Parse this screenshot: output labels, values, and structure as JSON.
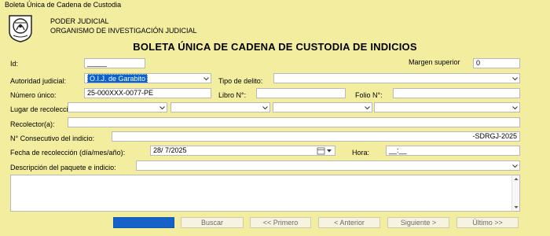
{
  "window": {
    "title": "Boleta Única de Cadena de Custodia"
  },
  "header": {
    "org_line1": "PODER JUDICIAL",
    "org_line2": "ORGANISMO DE INVESTIGACIÓN JUDICIAL",
    "title": "BOLETA ÚNICA DE CADENA DE CUSTODIA DE INDICIOS"
  },
  "form": {
    "id_label": "Id:",
    "id_value": "_____",
    "margin_label": "Margen superior",
    "margin_value": "0",
    "authority_label": "Autoridad judicial:",
    "authority_value": "O.I.J. de Garabito",
    "crime_type_label": "Tipo de delito:",
    "crime_type_value": "",
    "unique_number_label": "Número único:",
    "unique_number_value": "25-000XXX-0077-PE",
    "book_label": "Libro N°:",
    "book_value": "",
    "folio_label": "Folio N°:",
    "folio_value": "",
    "collection_place_label": "Lugar de recolección:",
    "collector_label": "Recolector(a):",
    "collector_value": "",
    "consecutive_label": "N° Consecutivo del indicio:",
    "consecutive_value": "-SDRGJ-2025",
    "date_label": "Fecha de recolección (día/mes/año):",
    "date_value": "28/  7/2025",
    "time_label": "Hora:",
    "time_value": "__:__",
    "description_label": "Descripción del paquete e indicio:",
    "description_value": ""
  },
  "buttons": {
    "search": "Buscar",
    "first": "<< Primero",
    "previous": "< Anterior",
    "next": "Siguiente >",
    "last": "Último >>"
  },
  "colors": {
    "background": "#f3eda0",
    "selection": "#0a62d0",
    "primary_button": "#1563c9"
  }
}
